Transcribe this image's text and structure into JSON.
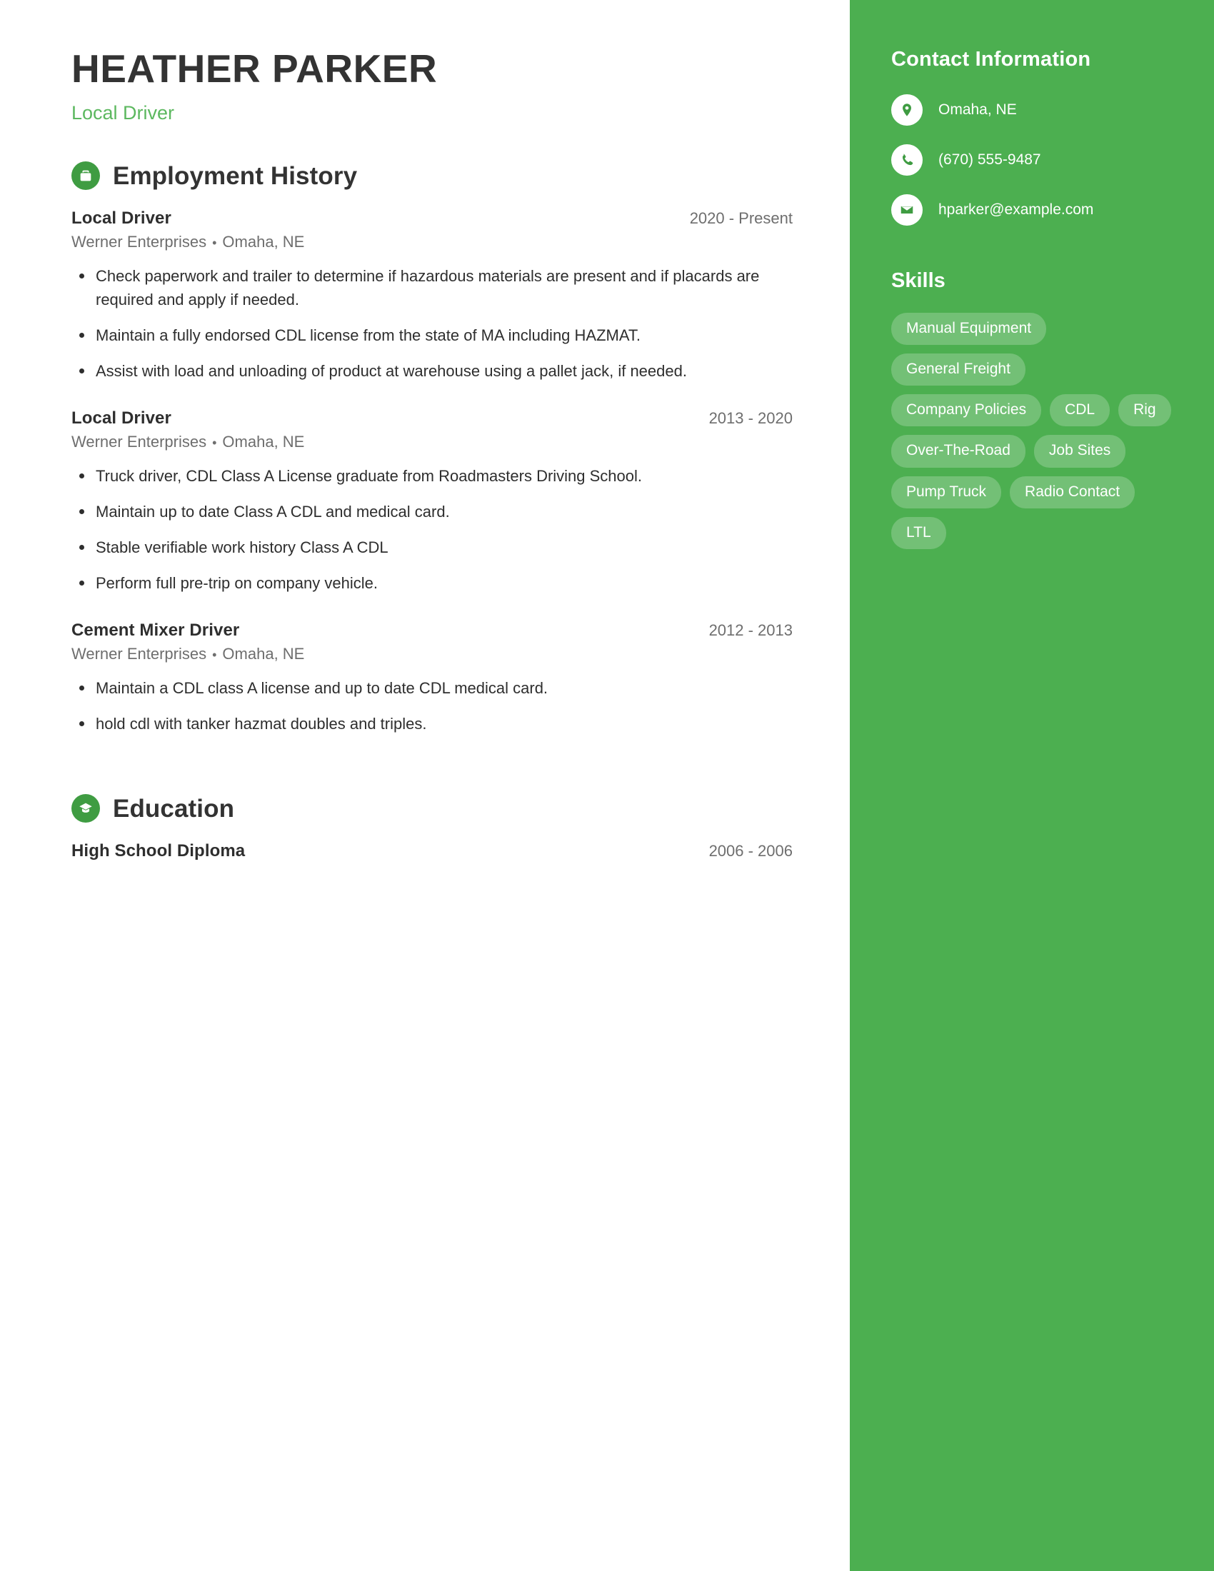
{
  "theme": {
    "accent_green": "#4caf50",
    "icon_green": "#3f9c42",
    "title_green": "#5cb85f",
    "text_dark": "#2e2e2e",
    "text_muted": "#6e6e6e"
  },
  "header": {
    "name": "HEATHER PARKER",
    "job_title": "Local Driver"
  },
  "employment": {
    "section_title": "Employment History",
    "icon": "briefcase-icon",
    "entries": [
      {
        "role": "Local Driver",
        "dates": "2020 - Present",
        "company": "Werner Enterprises",
        "separator": "•",
        "location": "Omaha, NE",
        "bullets": [
          "Check paperwork and trailer to determine if hazardous materials are present and if placards are required and apply if needed.",
          "Maintain a fully endorsed CDL license from the state of MA including HAZMAT.",
          "Assist with load and unloading of product at warehouse using a pallet jack, if needed."
        ]
      },
      {
        "role": "Local Driver",
        "dates": "2013 - 2020",
        "company": "Werner Enterprises",
        "separator": "•",
        "location": "Omaha, NE",
        "bullets": [
          "Truck driver, CDL Class A License graduate from Roadmasters Driving School.",
          "Maintain up to date Class A CDL and medical card.",
          "Stable verifiable work history Class A CDL",
          "Perform full pre-trip on company vehicle."
        ]
      },
      {
        "role": "Cement Mixer Driver",
        "dates": "2012 - 2013",
        "company": "Werner Enterprises",
        "separator": "•",
        "location": "Omaha, NE",
        "bullets": [
          "Maintain a CDL class A license and up to date CDL medical card.",
          "hold cdl with tanker hazmat doubles and triples."
        ]
      }
    ]
  },
  "education": {
    "section_title": "Education",
    "icon": "graduation-cap-icon",
    "entries": [
      {
        "degree": "High School Diploma",
        "dates": "2006 - 2006"
      }
    ]
  },
  "sidebar": {
    "contact_heading": "Contact Information",
    "contact": [
      {
        "icon": "location-pin-icon",
        "value": "Omaha, NE"
      },
      {
        "icon": "phone-icon",
        "value": "(670) 555-9487"
      },
      {
        "icon": "envelope-icon",
        "value": "hparker@example.com"
      }
    ],
    "skills_heading": "Skills",
    "skills": [
      "Manual Equipment",
      "General Freight",
      "Company Policies",
      "CDL",
      "Rig",
      "Over-The-Road",
      "Job Sites",
      "Pump Truck",
      "Radio Contact",
      "LTL"
    ]
  }
}
